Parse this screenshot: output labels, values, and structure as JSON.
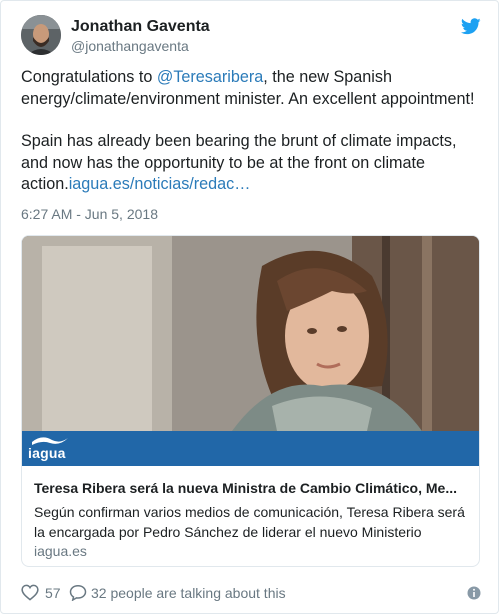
{
  "author": {
    "display_name": "Jonathan Gaventa",
    "handle": "@jonathangaventa",
    "avatar_icon": "profile-avatar"
  },
  "brand_icon": "twitter-bird-icon",
  "tweet": {
    "line1_pre": "Congratulations to ",
    "mention": "@Teresaribera",
    "line1_post": ", the new Spanish energy/climate/environment minister. An excellent appointment!",
    "para2": "Spain has already been bearing the brunt of climate impacts, and now has the opportunity to be at the front on climate action.",
    "link": "iagua.es/noticias/redac…",
    "timestamp": "6:27 AM - Jun 5, 2018"
  },
  "card": {
    "brand": "iagua",
    "title": "Teresa Ribera será la nueva Ministra de Cambio Climático, Me...",
    "description": "Según confirman varios medios de comunicación, Teresa Ribera será la encargada por Pedro Sánchez de liderar el nuevo Ministerio",
    "domain": "iagua.es"
  },
  "footer": {
    "likes": "57",
    "talking": "32 people are talking about this"
  },
  "colors": {
    "link": "#2b7bb9",
    "twitter_blue": "#1da1f2",
    "brand_banner": "#2167a8",
    "muted": "#697882"
  }
}
